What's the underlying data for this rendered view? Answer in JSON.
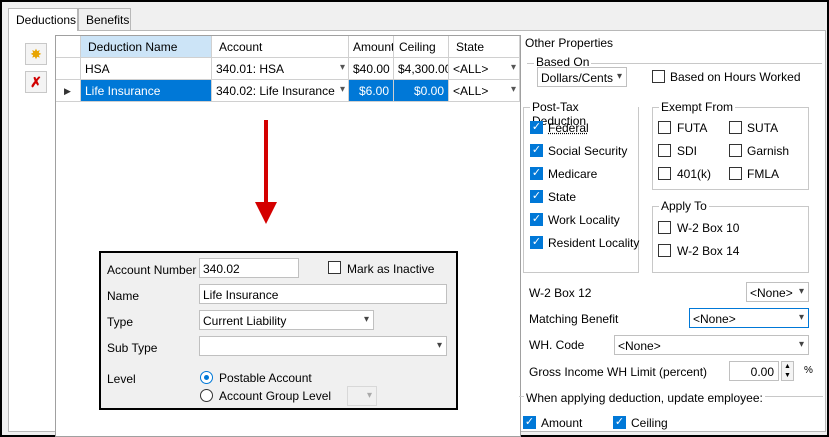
{
  "tabs": [
    {
      "label": "Deductions",
      "active": true
    },
    {
      "label": "Benefits",
      "active": false
    }
  ],
  "sidebar": {
    "add_icon": "sun-add-icon",
    "delete_icon": "red-x-delete-icon"
  },
  "grid": {
    "columns": [
      "Deduction Name",
      "Account",
      "Amount",
      "Ceiling",
      "State"
    ],
    "rows": [
      {
        "name": "HSA",
        "account": "340.01: HSA",
        "amount": "$40.00",
        "ceiling": "$4,300.00",
        "state": "<ALL>"
      },
      {
        "name": "Life Insurance",
        "account": "340.02: Life Insurance",
        "amount": "$6.00",
        "ceiling": "$0.00",
        "state": "<ALL>"
      }
    ],
    "row_indicator": "▶"
  },
  "detail": {
    "account_number_label": "Account Number",
    "account_number": "340.02",
    "inactive_label": "Mark as Inactive",
    "name_label": "Name",
    "name": "Life Insurance",
    "type_label": "Type",
    "type": "Current Liability",
    "subtype_label": "Sub Type",
    "subtype": "",
    "level_label": "Level",
    "postable_label": "Postable Account",
    "group_level_label": "Account Group Level"
  },
  "other": {
    "title": "Other Properties",
    "based_on_title": "Based On",
    "based_on_value": "Dollars/Cents",
    "hours_label": "Based on Hours Worked",
    "posttax_title": "Post-Tax Deduction",
    "posttax": [
      {
        "label": "Federal",
        "checked": true
      },
      {
        "label": "Social Security",
        "checked": true
      },
      {
        "label": "Medicare",
        "checked": true
      },
      {
        "label": "State",
        "checked": true
      },
      {
        "label": "Work Locality",
        "checked": true
      },
      {
        "label": "Resident Locality",
        "checked": true
      }
    ],
    "exempt_title": "Exempt From",
    "exempt": [
      {
        "label": "FUTA",
        "checked": false
      },
      {
        "label": "SUTA",
        "checked": false
      },
      {
        "label": "SDI",
        "checked": false
      },
      {
        "label": "Garnish",
        "checked": false
      },
      {
        "label": "401(k)",
        "checked": false
      },
      {
        "label": "FMLA",
        "checked": false
      }
    ],
    "apply_title": "Apply To",
    "apply": [
      {
        "label": "W-2 Box 10",
        "checked": false
      },
      {
        "label": "W-2 Box 14",
        "checked": false
      }
    ],
    "w2_box12_label": "W-2 Box 12",
    "w2_box12_value": "<None>",
    "matching_label": "Matching Benefit",
    "matching_value": "<None>",
    "wh_code_label": "WH. Code",
    "wh_code_value": "<None>",
    "gross_label": "Gross Income WH Limit (percent)",
    "gross_value": "0.00",
    "gross_unit": "%",
    "update_title": "When applying deduction, update employee:",
    "amount_label": "Amount",
    "ceiling_label": "Ceiling"
  }
}
